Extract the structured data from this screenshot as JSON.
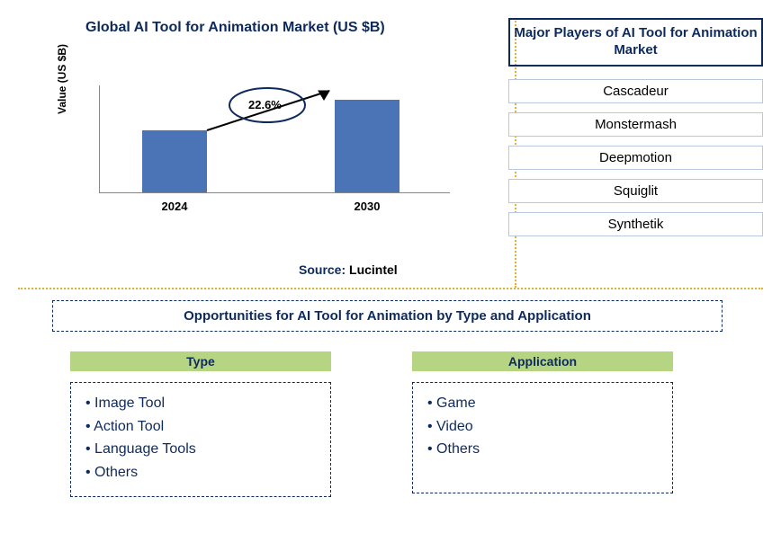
{
  "chart": {
    "title": "Global AI Tool for Animation Market (US $B)",
    "ylabel": "Value (US $B)",
    "cagr": "22.6%",
    "source_label": "Source:",
    "source_value": "Lucintel"
  },
  "players": {
    "title": "Major Players of AI Tool for Animation Market",
    "list": [
      "Cascadeur",
      "Monstermash",
      "Deepmotion",
      "Squiglit",
      "Synthetik"
    ]
  },
  "bottom": {
    "banner": "Opportunities for AI Tool for Animation by Type and Application",
    "type_header": "Type",
    "app_header": "Application",
    "types": [
      "Image Tool",
      "Action Tool",
      "Language Tools",
      "Others"
    ],
    "apps": [
      "Game",
      "Video",
      "Others"
    ]
  },
  "chart_data": {
    "type": "bar",
    "categories": [
      "2024",
      "2030"
    ],
    "values": [
      100,
      150
    ],
    "value_note": "relative heights only; absolute $B values not labeled on chart",
    "cagr_percent": 22.6,
    "title": "Global AI Tool for Animation Market (US $B)",
    "xlabel": "",
    "ylabel": "Value (US $B)",
    "ylim": [
      0,
      160
    ],
    "colors": {
      "bar": "#4a74b5"
    }
  }
}
